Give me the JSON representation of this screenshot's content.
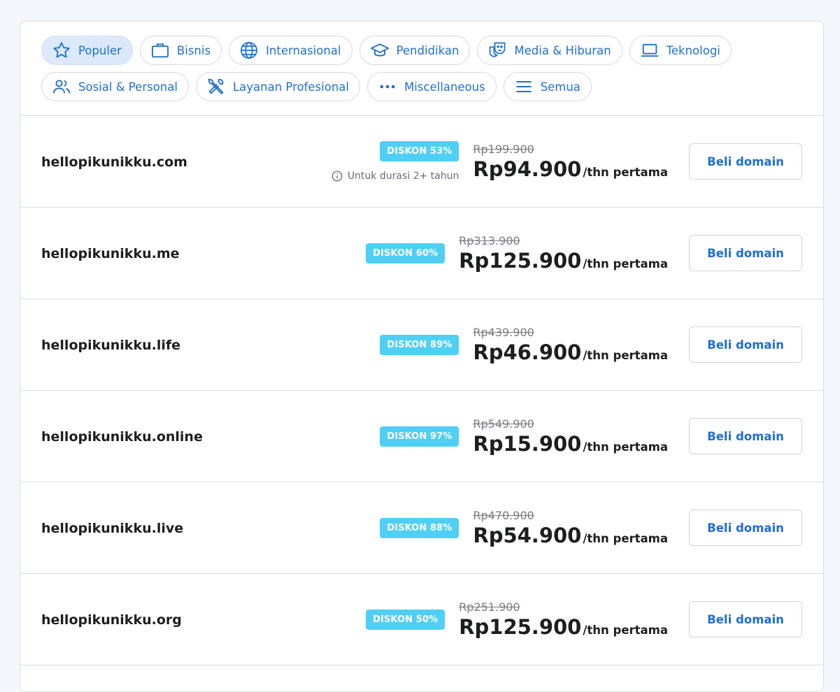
{
  "filters": [
    {
      "label": "Populer",
      "icon": "star-icon",
      "active": true
    },
    {
      "label": "Bisnis",
      "icon": "briefcase-icon"
    },
    {
      "label": "Internasional",
      "icon": "globe-icon"
    },
    {
      "label": "Pendidikan",
      "icon": "graduation-cap-icon"
    },
    {
      "label": "Media & Hiburan",
      "icon": "theater-masks-icon"
    },
    {
      "label": "Teknologi",
      "icon": "laptop-icon"
    },
    {
      "label": "Sosial & Personal",
      "icon": "users-icon"
    },
    {
      "label": "Layanan Profesional",
      "icon": "tools-icon"
    },
    {
      "label": "Miscellaneous",
      "icon": "more-dots-icon"
    },
    {
      "label": "Semua",
      "icon": "menu-lines-icon"
    }
  ],
  "results": [
    {
      "domain": "hellopikunikku.com",
      "badge": "DISKON 53%",
      "note": "Untuk durasi 2+ tahun",
      "old_price": "Rp199.900",
      "price": "Rp94.900",
      "per": "/thn pertama",
      "button": "Beli domain"
    },
    {
      "domain": "hellopikunikku.me",
      "badge": "DISKON 60%",
      "old_price": "Rp313.900",
      "price": "Rp125.900",
      "per": "/thn pertama",
      "button": "Beli domain"
    },
    {
      "domain": "hellopikunikku.life",
      "badge": "DISKON 89%",
      "old_price": "Rp439.900",
      "price": "Rp46.900",
      "per": "/thn pertama",
      "button": "Beli domain"
    },
    {
      "domain": "hellopikunikku.online",
      "badge": "DISKON 97%",
      "old_price": "Rp549.900",
      "price": "Rp15.900",
      "per": "/thn pertama",
      "button": "Beli domain"
    },
    {
      "domain": "hellopikunikku.live",
      "badge": "DISKON 88%",
      "old_price": "Rp470.900",
      "price": "Rp54.900",
      "per": "/thn pertama",
      "button": "Beli domain"
    },
    {
      "domain": "hellopikunikku.org",
      "badge": "DISKON 50%",
      "old_price": "Rp251.900",
      "price": "Rp125.900",
      "per": "/thn pertama",
      "button": "Beli domain"
    }
  ],
  "colors": {
    "accent": "#1f6fd1",
    "badge": "#50cff5",
    "active_chip_bg": "#dbe9fb",
    "text_dark": "#1d1e20"
  }
}
